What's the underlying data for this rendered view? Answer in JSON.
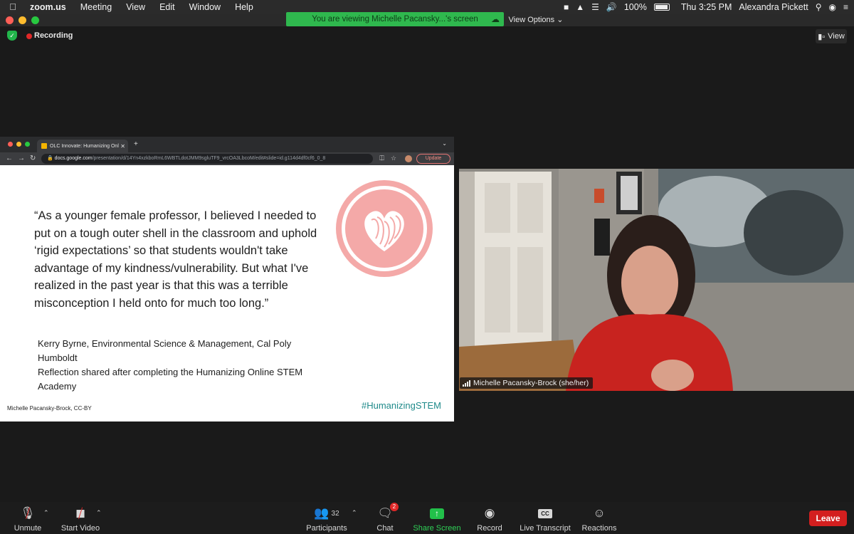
{
  "menubar": {
    "apple_icon": "apple-logo",
    "app_name": "zoom.us",
    "menus": [
      "Meeting",
      "View",
      "Edit",
      "Window",
      "Help"
    ],
    "battery": "100%",
    "clock": "Thu 3:25 PM",
    "user": "Alexandra Pickett"
  },
  "banner": {
    "text": "You are viewing Michelle Pacansky...'s screen",
    "view_options": "View Options ⌄"
  },
  "meeting": {
    "recording_label": "Recording",
    "view_label": "View"
  },
  "shared_screen": {
    "tab_title": "OLC Innovate: Humanizing Onl",
    "url_domain": "docs.google.com",
    "url_path": "/presentation/d/14Yn4xzkboRmL6WBTLdotJMM9sgluTF9_vrcOA3LbcoM/edit#slide=id.g114d4df0cf6_0_8",
    "update_label": "Update",
    "slide": {
      "quote": "“As a younger female professor, I believed I needed to put on a tough outer shell in the classroom and uphold ‘rigid expectations’ so that students wouldn't take advantage of my kindness/vulnerability. But what I've realized in the past year is that this was a terrible misconception I held onto for much too long.”",
      "attribution_line1": "Kerry Byrne, Environmental Science & Management, Cal Poly Humboldt",
      "attribution_line2": "Reflection shared after completing the Humanizing Online STEM Academy",
      "credit": "Michelle Pacansky-Brock, CC-BY",
      "hashtag": "#HumanizingSTEM"
    }
  },
  "participant": {
    "name": "Michelle Pacansky-Brock (she/her)"
  },
  "toolbar": {
    "unmute": "Unmute",
    "start_video": "Start Video",
    "participants": "Participants",
    "participants_count": "32",
    "chat": "Chat",
    "chat_badge": "2",
    "share_screen": "Share Screen",
    "record": "Record",
    "live_transcript": "Live Transcript",
    "cc_label": "CC",
    "reactions": "Reactions",
    "leave": "Leave"
  },
  "colors": {
    "share_green": "#2fd157",
    "leave_red": "#d31f1f",
    "hashtag_teal": "#1f8a8a",
    "heart_pink": "#f4a9a8"
  }
}
